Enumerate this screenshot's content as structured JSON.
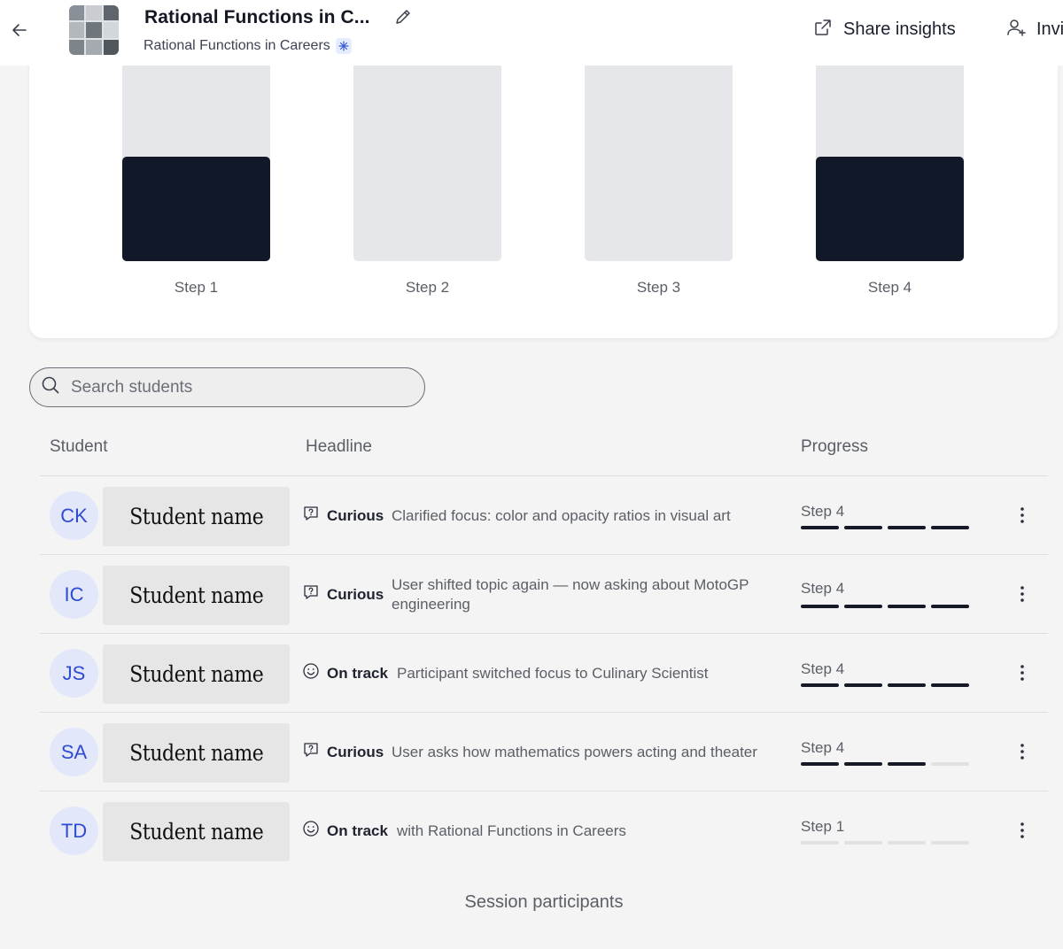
{
  "header": {
    "title": "Rational Functions in C...",
    "subtitle": "Rational Functions in Careers",
    "share_label": "Share insights",
    "invite_label": "Invi"
  },
  "chart_data": {
    "type": "bar",
    "categories": [
      "Step 1",
      "Step 2",
      "Step 3",
      "Step 4"
    ],
    "values": [
      2,
      0,
      0,
      2
    ],
    "ylim": [
      0,
      5
    ],
    "bar_color": "#111827",
    "track_color": "#e5e7eb"
  },
  "search": {
    "placeholder": "Search students"
  },
  "table": {
    "columns": [
      "Student",
      "Headline",
      "Progress"
    ],
    "rows": [
      {
        "initials": "CK",
        "name": "Student name",
        "status": "Curious",
        "status_icon": "question-bubble-icon",
        "headline": "Clarified focus: color and opacity ratios in visual art",
        "step": "Step 4",
        "progress": 4
      },
      {
        "initials": "IC",
        "name": "Student name",
        "status": "Curious",
        "status_icon": "question-bubble-icon",
        "headline": "User shifted topic again — now asking about MotoGP engineering",
        "step": "Step 4",
        "progress": 4
      },
      {
        "initials": "JS",
        "name": "Student name",
        "status": "On track",
        "status_icon": "smiley-icon",
        "headline": "Participant switched focus to Culinary Scientist",
        "step": "Step 4",
        "progress": 4
      },
      {
        "initials": "SA",
        "name": "Student name",
        "status": "Curious",
        "status_icon": "question-bubble-icon",
        "headline": "User asks how mathematics powers acting and theater",
        "step": "Step 4",
        "progress": 3
      },
      {
        "initials": "TD",
        "name": "Student name",
        "status": "On track",
        "status_icon": "smiley-icon",
        "headline": "with Rational Functions in Careers",
        "step": "Step 1",
        "progress": 0
      }
    ]
  },
  "footer": {
    "label": "Session participants"
  },
  "colors": {
    "avatar_bg": "#e3e7fa",
    "avatar_text": "#2f4bd1",
    "progress_on": "#161a27",
    "progress_off": "#e1e1e1"
  }
}
